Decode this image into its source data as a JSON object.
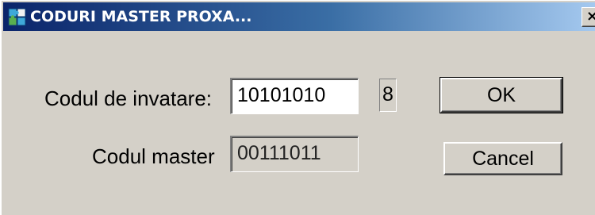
{
  "window": {
    "title": "CODURI MASTER PROXA...",
    "icon": "puzzle-icon",
    "close_glyph": "×"
  },
  "form": {
    "learn_code_label": "Codul de invatare:",
    "learn_code_value": "10101010",
    "learn_code_count": "8",
    "master_code_label": "Codul master",
    "master_code_value": "00111011"
  },
  "buttons": {
    "ok_label": "OK",
    "cancel_label": "Cancel"
  },
  "colors": {
    "titlebar_start": "#0a246a",
    "titlebar_end": "#a6caf0",
    "face": "#d4d0c8"
  }
}
